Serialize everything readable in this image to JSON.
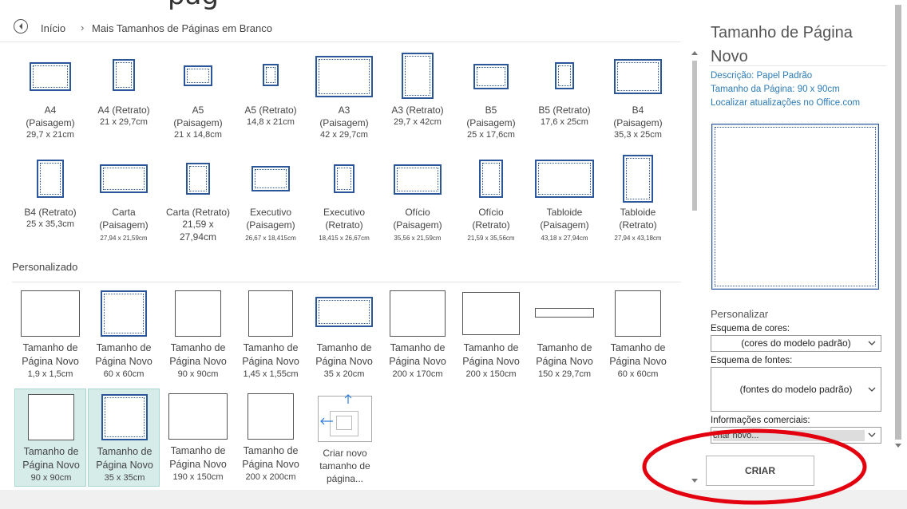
{
  "header": {
    "title_fragment": "pág"
  },
  "breadcrumb": {
    "home": "Início",
    "separator": "›",
    "current": "Mais Tamanhos de Páginas em Branco"
  },
  "standard_templates": [
    {
      "label": "A4 (Paisagem)",
      "label_lines": [
        "A4",
        "(Paisagem)"
      ],
      "size": "29,7 x 21cm"
    },
    {
      "label": "A4 (Retrato)",
      "label_lines": [
        "A4 (Retrato)"
      ],
      "size": "21 x 29,7cm"
    },
    {
      "label": "A5 (Paisagem)",
      "label_lines": [
        "A5",
        "(Paisagem)"
      ],
      "size": "21 x 14,8cm"
    },
    {
      "label": "A5 (Retrato)",
      "label_lines": [
        "A5 (Retrato)"
      ],
      "size": "14,8 x 21cm"
    },
    {
      "label": "A3 (Paisagem)",
      "label_lines": [
        "A3",
        "(Paisagem)"
      ],
      "size": "42 x 29,7cm"
    },
    {
      "label": "A3 (Retrato)",
      "label_lines": [
        "A3 (Retrato)"
      ],
      "size": "29,7 x 42cm"
    },
    {
      "label": "B5 (Paisagem)",
      "label_lines": [
        "B5",
        "(Paisagem)"
      ],
      "size": "25 x 17,6cm"
    },
    {
      "label": "B5 (Retrato)",
      "label_lines": [
        "B5 (Retrato)"
      ],
      "size": "17,6 x 25cm"
    },
    {
      "label": "B4 (Paisagem)",
      "label_lines": [
        "B4",
        "(Paisagem)"
      ],
      "size": "35,3 x 25cm"
    },
    {
      "label": "B4 (Retrato)",
      "label_lines": [
        "B4 (Retrato)"
      ],
      "size": "25 x 35,3cm"
    },
    {
      "label": "Carta (Paisagem)",
      "label_lines": [
        "Carta",
        "(Paisagem)"
      ],
      "size": "27,94 x 21,59cm"
    },
    {
      "label": "Carta (Retrato)",
      "label_lines": [
        "Carta (Retrato)"
      ],
      "size_lines": [
        "21,59 x",
        "27,94cm"
      ]
    },
    {
      "label": "Executivo (Paisagem)",
      "label_lines": [
        "Executivo",
        "(Paisagem)"
      ],
      "size": "26,67 x 18,415cm"
    },
    {
      "label": "Executivo (Retrato)",
      "label_lines": [
        "Executivo",
        "(Retrato)"
      ],
      "size": "18,415 x 26,67cm"
    },
    {
      "label": "Ofício (Paisagem)",
      "label_lines": [
        "Ofício",
        "(Paisagem)"
      ],
      "size": "35,56 x 21,59cm"
    },
    {
      "label": "Ofício (Retrato)",
      "label_lines": [
        "Ofício",
        "(Retrato)"
      ],
      "size": "21,59 x 35,56cm"
    },
    {
      "label": "Tabloide (Paisagem)",
      "label_lines": [
        "Tabloide",
        "(Paisagem)"
      ],
      "size": "43,18 x 27,94cm"
    },
    {
      "label": "Tabloide (Retrato)",
      "label_lines": [
        "Tabloide",
        "(Retrato)"
      ],
      "size": "27,94 x 43,18cm"
    }
  ],
  "custom_section_title": "Personalizado",
  "custom_templates": [
    {
      "name_lines": [
        "Tamanho de",
        "Página Novo"
      ],
      "size": "1,9 x 1,5cm"
    },
    {
      "name_lines": [
        "Tamanho de",
        "Página Novo"
      ],
      "size": "60 x 60cm"
    },
    {
      "name_lines": [
        "Tamanho de",
        "Página Novo"
      ],
      "size": "90 x 90cm"
    },
    {
      "name_lines": [
        "Tamanho de",
        "Página Novo"
      ],
      "size": "1,45 x 1,55cm"
    },
    {
      "name_lines": [
        "Tamanho de",
        "Página Novo"
      ],
      "size": "35 x 20cm"
    },
    {
      "name_lines": [
        "Tamanho de",
        "Página Novo"
      ],
      "size": "200 x 170cm"
    },
    {
      "name_lines": [
        "Tamanho de",
        "Página Novo"
      ],
      "size": "200 x 150cm"
    },
    {
      "name_lines": [
        "Tamanho de",
        "Página Novo"
      ],
      "size": "150 x 29,7cm"
    },
    {
      "name_lines": [
        "Tamanho de",
        "Página Novo"
      ],
      "size": "60 x 60cm"
    },
    {
      "name_lines": [
        "Tamanho de",
        "Página Novo"
      ],
      "size": "90 x 90cm",
      "selected": true
    },
    {
      "name_lines": [
        "Tamanho de",
        "Página Novo"
      ],
      "size": "35 x 35cm",
      "selected": true
    },
    {
      "name_lines": [
        "Tamanho de",
        "Página Novo"
      ],
      "size": "190 x 150cm"
    },
    {
      "name_lines": [
        "Tamanho de",
        "Página Novo"
      ],
      "size": "200 x 200cm"
    }
  ],
  "create_new_size": {
    "lines": [
      "Criar novo",
      "tamanho de",
      "página..."
    ]
  },
  "details_panel": {
    "title_lines": [
      "Tamanho de Página",
      "Novo"
    ],
    "description": "Descrição: Papel Padrão",
    "page_size": "Tamanho da Página: 90 x 90cm",
    "updates_link": "Localizar atualizações no Office.com",
    "customize_title": "Personalizar",
    "color_scheme_label": "Esquema de cores:",
    "color_scheme_value": "(cores do modelo padrão)",
    "font_scheme_label": "Esquema de fontes:",
    "font_scheme_value": "(fontes do modelo padrão)",
    "business_info_label": "Informações comerciais:",
    "business_info_value": "criar novo...",
    "create_button": "CRIAR"
  },
  "colors": {
    "accent_blue": "#2b579a",
    "selection_bg": "#d6ece8",
    "link": "#2c7bb6",
    "annotation_red": "#e3000f"
  }
}
